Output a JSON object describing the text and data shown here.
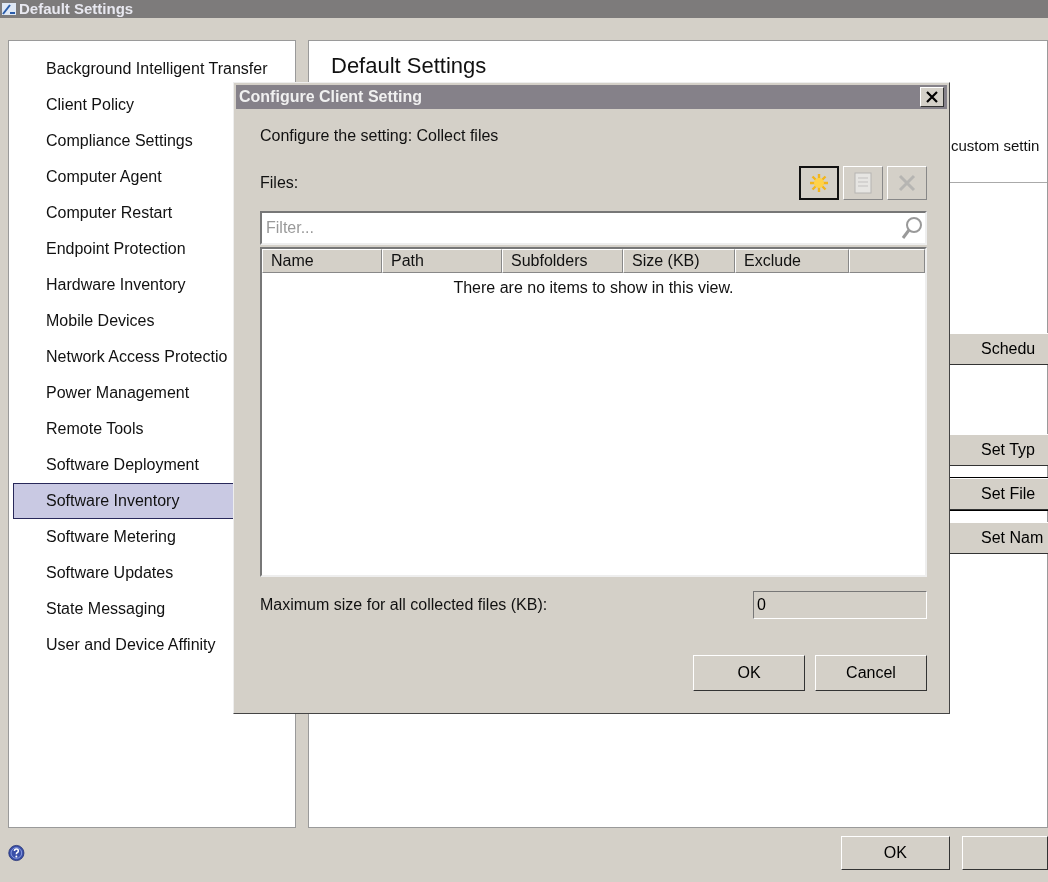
{
  "window": {
    "title": "Default Settings"
  },
  "sidebar": {
    "items": [
      {
        "label": "Background Intelligent Transfer",
        "selected": false
      },
      {
        "label": "Client Policy",
        "selected": false
      },
      {
        "label": "Compliance Settings",
        "selected": false
      },
      {
        "label": "Computer Agent",
        "selected": false
      },
      {
        "label": "Computer Restart",
        "selected": false
      },
      {
        "label": "Endpoint Protection",
        "selected": false
      },
      {
        "label": "Hardware Inventory",
        "selected": false
      },
      {
        "label": "Mobile Devices",
        "selected": false
      },
      {
        "label": "Network Access Protectio",
        "selected": false
      },
      {
        "label": "Power Management",
        "selected": false
      },
      {
        "label": "Remote Tools",
        "selected": false
      },
      {
        "label": "Software Deployment",
        "selected": false
      },
      {
        "label": "Software Inventory",
        "selected": true
      },
      {
        "label": "Software Metering",
        "selected": false
      },
      {
        "label": "Software Updates",
        "selected": false
      },
      {
        "label": "State Messaging",
        "selected": false
      },
      {
        "label": "User and Device Affinity",
        "selected": false
      }
    ]
  },
  "panel": {
    "heading": "Default Settings",
    "description": "custom settin",
    "buttons": [
      {
        "label": "Schedu",
        "focused": false
      },
      {
        "label": "Set Typ",
        "focused": false
      },
      {
        "label": "Set File",
        "focused": true
      },
      {
        "label": "Set Nam",
        "focused": false
      }
    ]
  },
  "footer": {
    "ok_button": "OK"
  },
  "dialog": {
    "title": "Configure Client Setting",
    "setting_label": "Configure the setting: Collect files",
    "files_label": "Files:",
    "toolbar": [
      {
        "kind": "new",
        "disabled": false,
        "focused": true
      },
      {
        "kind": "properties",
        "disabled": true,
        "focused": false
      },
      {
        "kind": "delete",
        "disabled": true,
        "focused": false
      }
    ],
    "filter": {
      "placeholder": "Filter..."
    },
    "columns": [
      "Name",
      "Path",
      "Subfolders",
      "Size (KB)",
      "Exclude"
    ],
    "empty_message": "There are no items to show in this view.",
    "max_size": {
      "label": "Maximum size for all collected files (KB):",
      "value": "0",
      "disabled": true
    },
    "buttons": [
      "OK",
      "Cancel"
    ]
  }
}
